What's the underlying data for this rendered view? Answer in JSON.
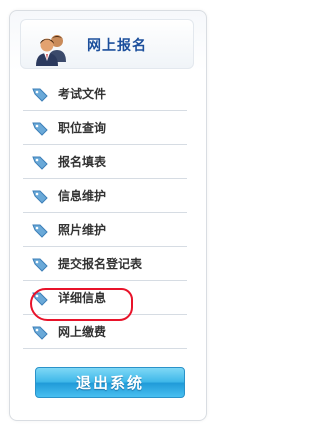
{
  "header": {
    "title": "网上报名",
    "icon": "users-icon"
  },
  "menu": {
    "items": [
      {
        "label": "考试文件",
        "icon": "tag-icon"
      },
      {
        "label": "职位查询",
        "icon": "tag-icon"
      },
      {
        "label": "报名填表",
        "icon": "tag-icon"
      },
      {
        "label": "信息维护",
        "icon": "tag-icon"
      },
      {
        "label": "照片维护",
        "icon": "tag-icon"
      },
      {
        "label": "提交报名登记表",
        "icon": "tag-icon"
      },
      {
        "label": "详细信息",
        "icon": "tag-icon"
      },
      {
        "label": "网上缴费",
        "icon": "tag-icon"
      }
    ]
  },
  "logout": {
    "label": "退出系统"
  },
  "colors": {
    "accent": "#1c4f9c",
    "button": "#3cb6e8",
    "highlight": "#e8132a"
  }
}
